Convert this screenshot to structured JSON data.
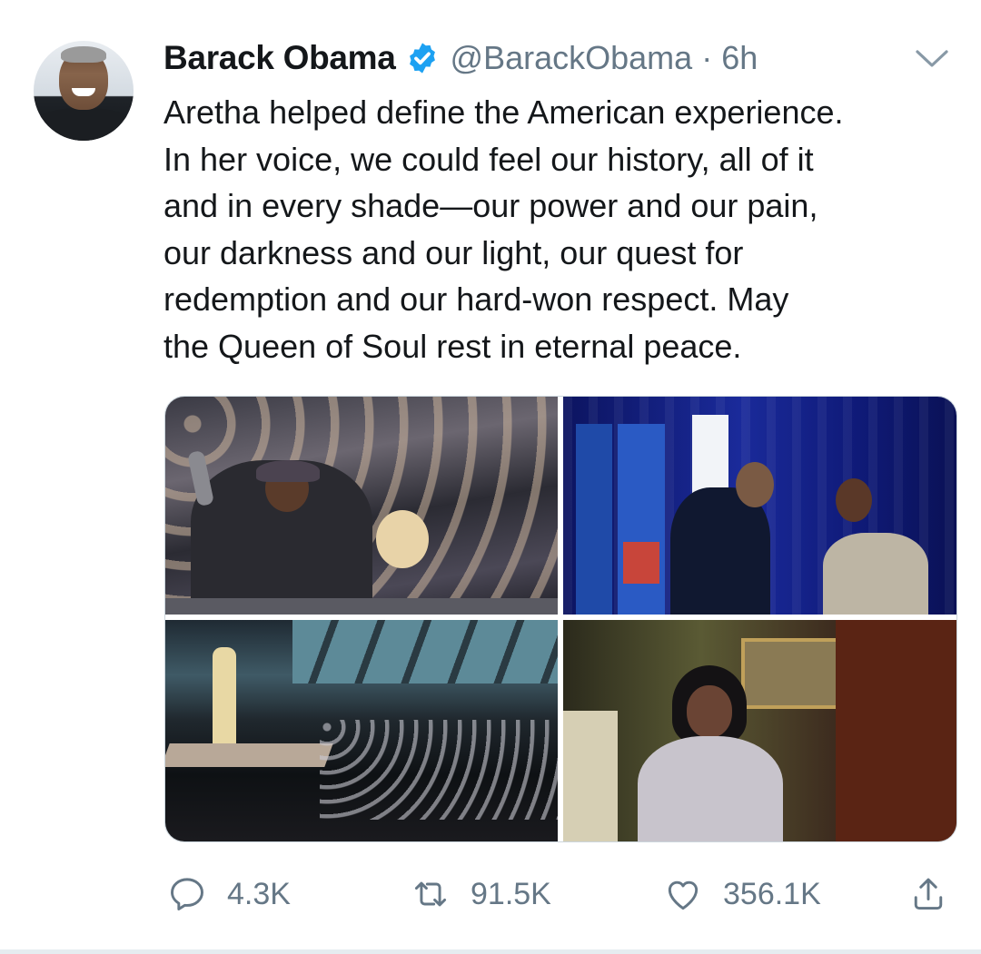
{
  "tweet": {
    "author_name": "Barack Obama",
    "handle": "@BarackObama",
    "separator": "·",
    "time": "6h",
    "verified": true,
    "text": "Aretha helped define the American experience.\nIn her voice, we could feel our history, all of it\nand in every shade—our power and our pain,\nour darkness and our light, our quest for\nredemption and our hard-won respect. May\nthe Queen of Soul rest in eternal peace.",
    "media": [
      {
        "icon": "photo-crowd-inauguration"
      },
      {
        "icon": "photo-flags-stage"
      },
      {
        "icon": "photo-concert-hall"
      },
      {
        "icon": "photo-fur-coat"
      }
    ]
  },
  "actions": {
    "replies": "4.3K",
    "retweets": "91.5K",
    "likes": "356.1K"
  },
  "colors": {
    "text": "#14171a",
    "secondary": "#657786",
    "verified": "#1da1f2",
    "border": "#ccd6dd"
  },
  "icons": {
    "avatar": "profile-avatar",
    "verified": "verified-badge-icon",
    "caret": "chevron-down-icon",
    "reply": "reply-icon",
    "retweet": "retweet-icon",
    "like": "heart-icon",
    "share": "share-icon"
  }
}
